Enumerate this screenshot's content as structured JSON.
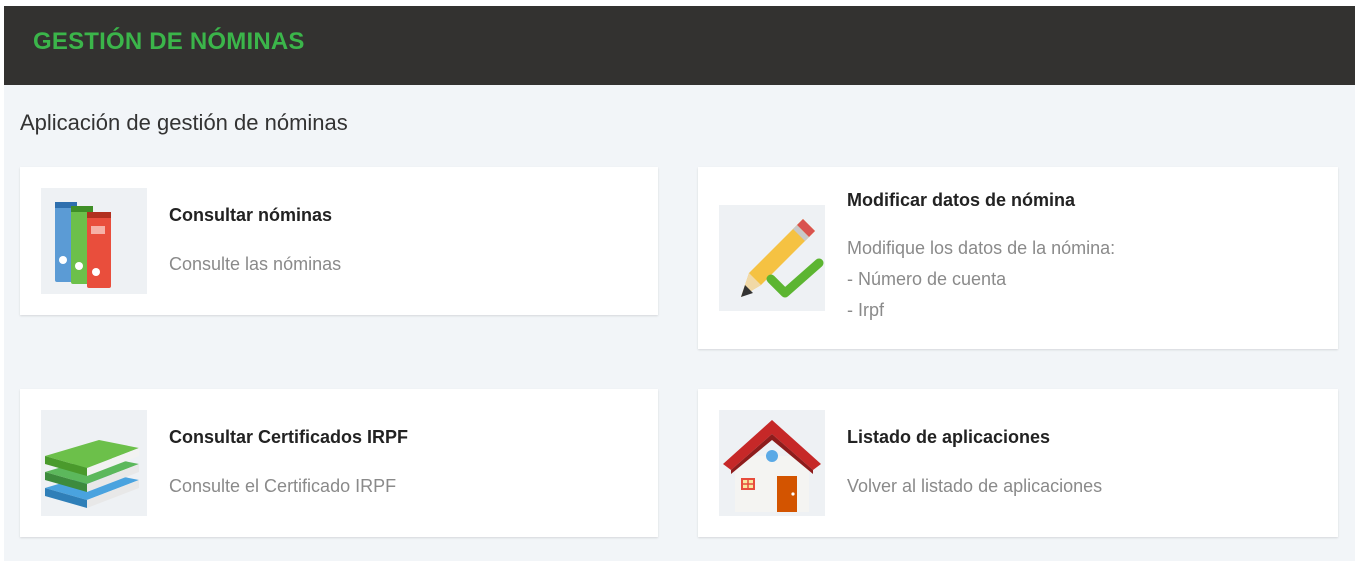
{
  "header": {
    "title": "GESTIÓN DE NÓMINAS"
  },
  "page": {
    "subtitle": "Aplicación de gestión de nóminas"
  },
  "colors": {
    "header_bg": "#333230",
    "header_title": "#3bb54a",
    "page_bg": "#f2f5f8",
    "card_bg": "#ffffff"
  },
  "cards": [
    {
      "title": "Consultar nóminas",
      "description": [
        "Consulte las nóminas"
      ],
      "icon": "binders-icon"
    },
    {
      "title": "Modificar datos de nómina",
      "description": [
        "Modifique los datos de la nómina:",
        "- Número de cuenta",
        "- Irpf"
      ],
      "icon": "pencil-check-icon"
    },
    {
      "title": "Consultar Certificados IRPF",
      "description": [
        "Consulte el Certificado IRPF"
      ],
      "icon": "stacked-folders-icon"
    },
    {
      "title": "Listado de aplicaciones",
      "description": [
        "Volver al listado de aplicaciones"
      ],
      "icon": "home-icon"
    }
  ]
}
